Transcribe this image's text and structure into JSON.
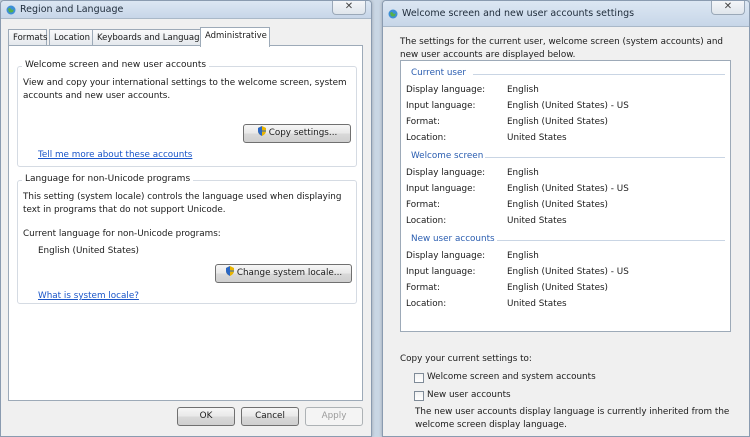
{
  "left_window": {
    "title": "Region and Language",
    "close_glyph": "✕",
    "tabs": [
      "Formats",
      "Location",
      "Keyboards and Languages",
      "Administrative"
    ],
    "welcome_group": {
      "title": "Welcome screen and new user accounts",
      "description": "View and copy your international settings to the welcome screen, system accounts and new user accounts.",
      "copy_button": "Copy settings...",
      "link": "Tell me more about these accounts"
    },
    "unicode_group": {
      "title": "Language for non-Unicode programs",
      "description": "This setting (system locale) controls the language used when displaying text in programs that do not support Unicode.",
      "current_label": "Current language for non-Unicode programs:",
      "current_value": "English (United States)",
      "change_button": "Change system locale...",
      "link": "What is system locale?"
    },
    "buttons": {
      "ok": "OK",
      "cancel": "Cancel",
      "apply": "Apply"
    }
  },
  "right_window": {
    "title": "Welcome screen and new user accounts settings",
    "close_glyph": "✕",
    "intro": "The settings for the current user, welcome screen (system accounts) and new user accounts are displayed below.",
    "sections": [
      {
        "title": "Current user",
        "rows": [
          {
            "key": "Display language:",
            "value": "English"
          },
          {
            "key": "Input language:",
            "value": "English (United States) - US"
          },
          {
            "key": "Format:",
            "value": "English (United States)"
          },
          {
            "key": "Location:",
            "value": "United States"
          }
        ]
      },
      {
        "title": "Welcome screen",
        "rows": [
          {
            "key": "Display language:",
            "value": "English"
          },
          {
            "key": "Input language:",
            "value": "English (United States) - US"
          },
          {
            "key": "Format:",
            "value": "English (United States)"
          },
          {
            "key": "Location:",
            "value": "United States"
          }
        ]
      },
      {
        "title": "New user accounts",
        "rows": [
          {
            "key": "Display language:",
            "value": "English"
          },
          {
            "key": "Input language:",
            "value": "English (United States) - US"
          },
          {
            "key": "Format:",
            "value": "English (United States)"
          },
          {
            "key": "Location:",
            "value": "United States"
          }
        ]
      }
    ],
    "copy_label": "Copy your current settings to:",
    "checkboxes": [
      {
        "label": "Welcome screen and system accounts",
        "checked": false
      },
      {
        "label": "New user accounts",
        "checked": false
      }
    ],
    "note": "The new user accounts display language is currently inherited from the welcome screen display language."
  }
}
